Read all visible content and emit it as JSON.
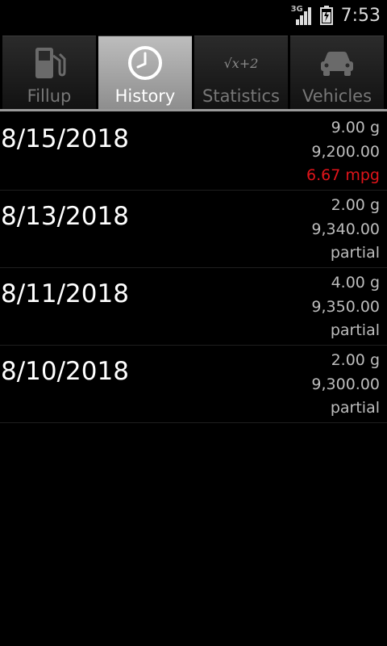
{
  "status": {
    "network": "3G",
    "time": "7:53"
  },
  "tabs": [
    {
      "label": "Fillup",
      "icon": "fuel-pump-icon",
      "selected": false
    },
    {
      "label": "History",
      "icon": "clock-icon",
      "selected": true
    },
    {
      "label": "Statistics",
      "icon": "formula-icon",
      "selected": false
    },
    {
      "label": "Vehicles",
      "icon": "car-icon",
      "selected": false
    }
  ],
  "statistics_icon_text": "√x+2",
  "entries": [
    {
      "date": "8/15/2018",
      "gallons": "9.00 g",
      "odometer": "9,200.00",
      "economy": "6.67 mpg",
      "economy_color": "#e0141a"
    },
    {
      "date": "8/13/2018",
      "gallons": "2.00 g",
      "odometer": "9,340.00",
      "economy": "partial",
      "economy_color": "#bdbdbd"
    },
    {
      "date": "8/11/2018",
      "gallons": "4.00 g",
      "odometer": "9,350.00",
      "economy": "partial",
      "economy_color": "#bdbdbd"
    },
    {
      "date": "8/10/2018",
      "gallons": "2.00 g",
      "odometer": "9,300.00",
      "economy": "partial",
      "economy_color": "#bdbdbd"
    }
  ]
}
